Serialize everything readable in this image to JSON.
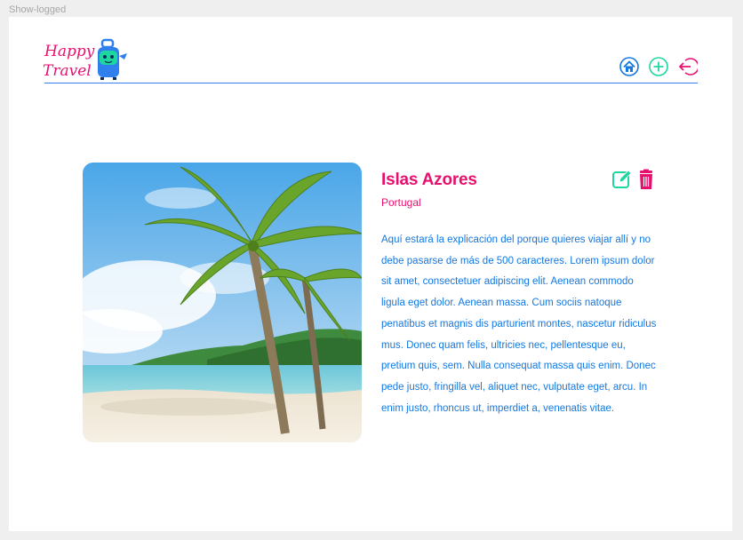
{
  "frame": {
    "label": "Show-logged"
  },
  "header": {
    "logo": {
      "line1": "Happy",
      "line2": "Travel"
    },
    "nav": [
      {
        "name": "home-icon",
        "label": "home"
      },
      {
        "name": "add-icon",
        "label": "add"
      },
      {
        "name": "logout-icon",
        "label": "logout"
      }
    ]
  },
  "destination": {
    "title": "Islas Azores",
    "country": "Portugal",
    "description": "Aquí estará la explicación del porque quieres viajar allí y no debe pasarse de más de 500 caracteres. Lorem ipsum dolor sit amet, consectetuer adipiscing elit. Aenean commodo ligula eget dolor. Aenean massa. Cum sociis natoque penatibus et magnis dis parturient montes, nascetur ridiculus mus. Donec quam felis, ultricies nec, pellentesque eu, pretium quis, sem. Nulla consequat massa quis enim. Donec pede justo, fringilla vel, aliquet nec, vulputate eget, arcu. In enim justo, rhoncus ut, imperdiet a, venenatis vitae."
  },
  "colors": {
    "accent_pink": "#e8106e",
    "accent_blue": "#1478e0",
    "accent_green": "#1ed6a0"
  }
}
